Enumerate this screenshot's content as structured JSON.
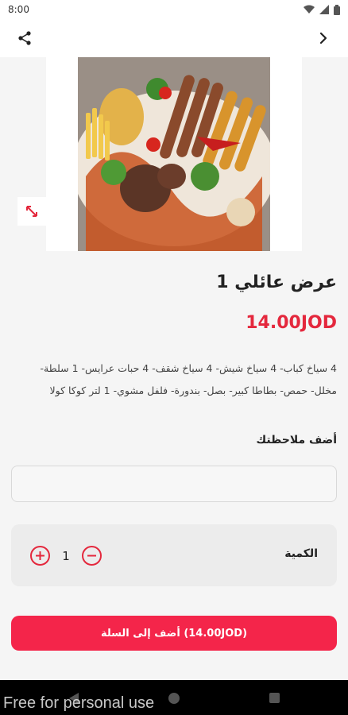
{
  "status": {
    "time": "8:00"
  },
  "product": {
    "title": "عرض عائلي 1",
    "price": "14.00JOD",
    "description": "4 سياخ كباب- 4 سياخ شيش- 4 سياخ شقف- 4 حبات عرايس- 1 سلطة- مخلل- حمص- بطاطا كبير- بصل- بندورة- فلفل مشوي- 1 لتر كوكا كولا"
  },
  "notes": {
    "label": "أضف ملاحظتك",
    "value": ""
  },
  "quantity": {
    "label": "الكمية",
    "value": "1"
  },
  "cart": {
    "button_label": "أضف إلى السلة (14.00JOD)"
  },
  "watermark": "Free for personal use",
  "colors": {
    "accent": "#f4254a",
    "price": "#e4283d"
  }
}
